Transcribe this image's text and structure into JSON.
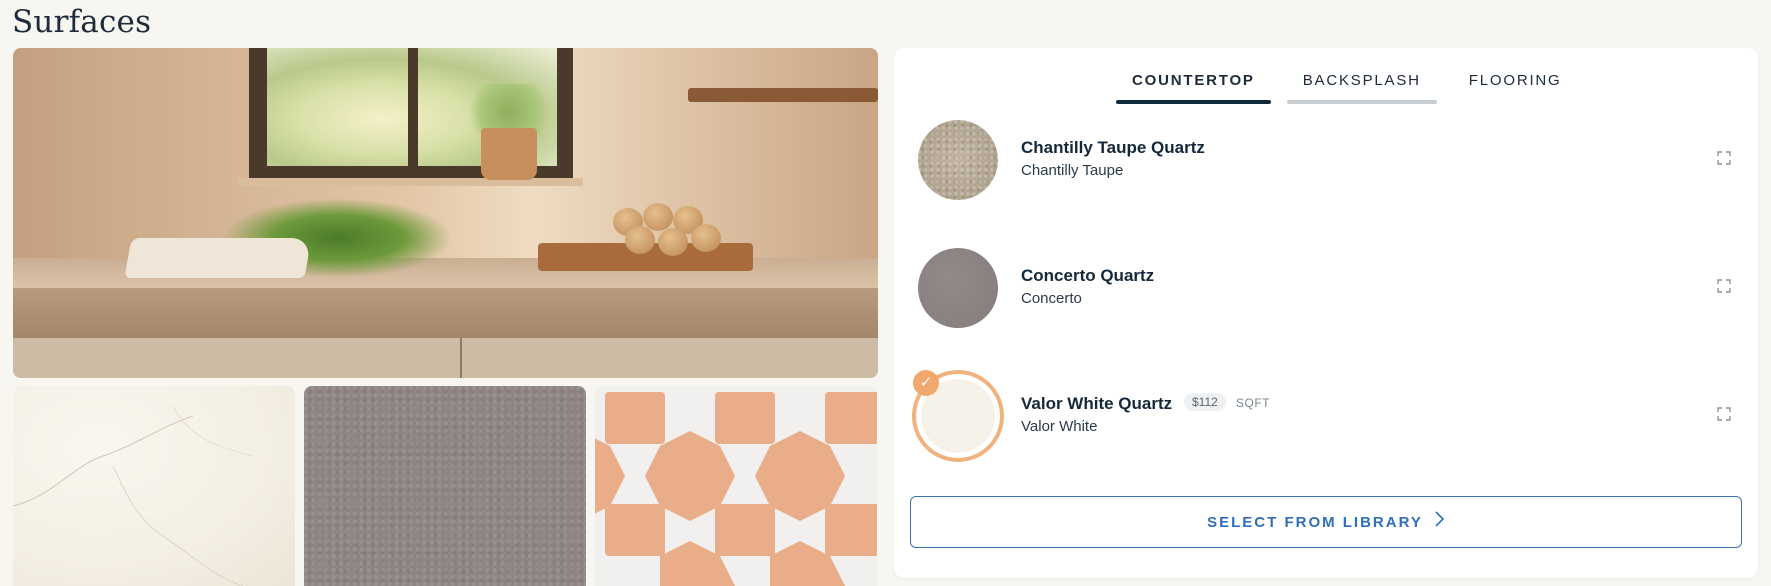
{
  "page": {
    "title": "Surfaces"
  },
  "tabs": [
    {
      "label": "COUNTERTOP"
    },
    {
      "label": "BACKSPLASH"
    },
    {
      "label": "FLOORING"
    }
  ],
  "materials": [
    {
      "name": "Chantilly Taupe Quartz",
      "subtitle": "Chantilly Taupe",
      "selected": false
    },
    {
      "name": "Concerto Quartz",
      "subtitle": "Concerto",
      "selected": false
    },
    {
      "name": "Valor White Quartz",
      "subtitle": "Valor White",
      "price": "$112",
      "unit": "SQFT",
      "selected": true
    }
  ],
  "library_button": {
    "label": "SELECT FROM LIBRARY"
  },
  "icons": {
    "expand": "expand-icon",
    "check": "check-icon",
    "chevron": "chevron-right-icon"
  },
  "colors": {
    "accent_blue": "#2f6fb7",
    "selected_ring": "#f0b27e",
    "active_tab": "#102a3e"
  }
}
